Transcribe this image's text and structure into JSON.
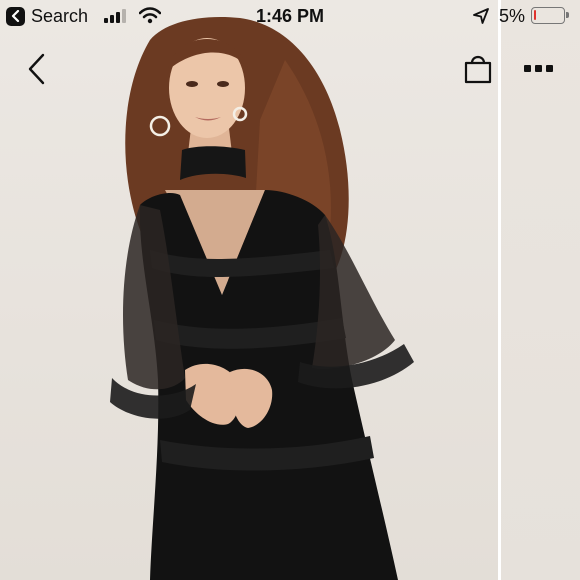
{
  "status_bar": {
    "back_app_label": "Search",
    "time": "1:46 PM",
    "battery_percent": "5%",
    "signal_bars_active": 3,
    "signal_bars_total": 4,
    "battery_level_fraction": 0.05,
    "battery_color": "#e0332e"
  },
  "nav": {
    "back_icon": "chevron-left-icon",
    "bag_icon": "shopping-bag-icon",
    "more_icon": "more-dots-icon"
  },
  "gallery": {
    "current_image": "Model wearing black mesh ruffle dress with sheer polka-dot long sleeves",
    "has_next_image": true
  }
}
